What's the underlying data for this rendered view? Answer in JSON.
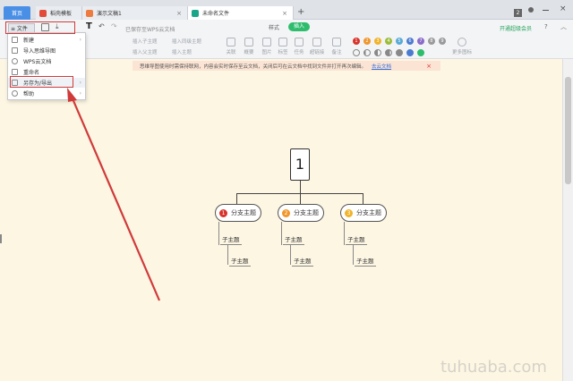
{
  "tabs": [
    {
      "label": "首页",
      "kind": "home"
    },
    {
      "label": "稻壳模板",
      "kind": "doc",
      "color": "#e24b3a"
    },
    {
      "label": "演示文稿1",
      "kind": "doc",
      "color": "#ee7b3f"
    },
    {
      "label": "未命名文件",
      "kind": "doc",
      "color": "#1aa58a",
      "active": true
    }
  ],
  "window": {
    "badge": "2",
    "add_tab": "+",
    "close": "×"
  },
  "toolbar": {
    "file_label": "≡ 文件",
    "save_status": "已保存至WPS云文档",
    "style_label": "样式",
    "insert_label": "插入",
    "vip_label": "开通超级会员",
    "help": "?",
    "collapse": "︿",
    "insert_items": [
      "插入子主题",
      "插入同级主题",
      "插入父主题",
      "插入主题"
    ],
    "big_items": [
      "关联",
      "概要",
      "图片",
      "标签",
      "任务",
      "超链接",
      "备注"
    ],
    "more_icons": "更多图标",
    "number_icons": [
      "1",
      "2",
      "3",
      "4",
      "5",
      "6",
      "7",
      "8",
      "9",
      "10"
    ]
  },
  "notify": {
    "text": "思维导图使用时需保持联网，内容会实时保存至云文档，关闭后可在云文档中找到文件并打开再次编辑。",
    "link": "去云文档",
    "close": "×"
  },
  "menu": {
    "items": [
      {
        "label": "新建",
        "has_arrow": true
      },
      {
        "label": "导入思维导图",
        "has_arrow": false
      },
      {
        "label": "WPS云文档",
        "has_arrow": false
      },
      {
        "label": "重命名",
        "has_arrow": false
      },
      {
        "label": "另存为/导出",
        "has_arrow": true,
        "highlight": true
      },
      {
        "label": "帮助",
        "has_arrow": true
      }
    ]
  },
  "mindmap": {
    "root": "1",
    "branches": [
      {
        "num": "1",
        "label": "分支主题",
        "color": "#d8342c",
        "subs": [
          "子主题",
          "子主题"
        ]
      },
      {
        "num": "2",
        "label": "分支主题",
        "color": "#f0962a",
        "subs": [
          "子主题",
          "子主题"
        ]
      },
      {
        "num": "3",
        "label": "分支主题",
        "color": "#f0b32a",
        "subs": [
          "子主题",
          "子主题"
        ]
      }
    ]
  },
  "watermark": "tuhuaba.com",
  "colors": {
    "accent_green": "#2ebd6d",
    "highlight_red": "#d03a3a",
    "canvas_bg": "#fdf6e3"
  }
}
